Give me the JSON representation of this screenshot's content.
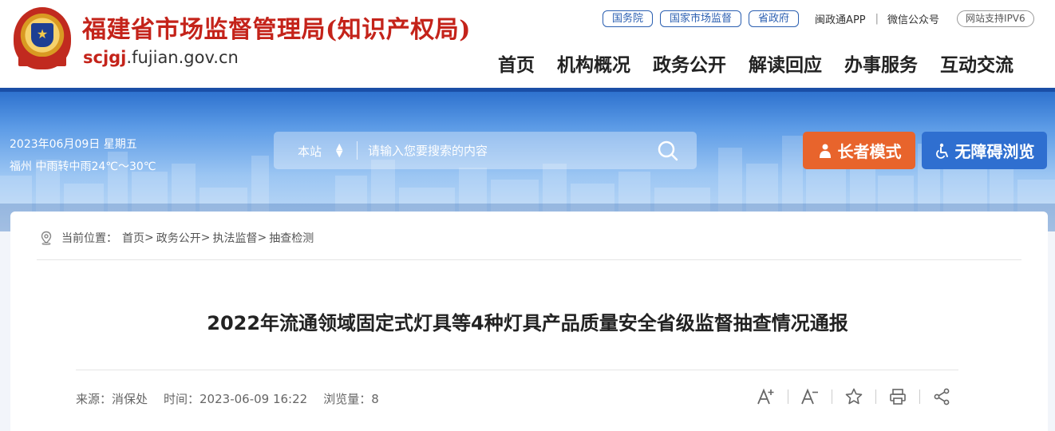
{
  "header": {
    "site_title": "福建省市场监督管理局(知识产权局)",
    "domain_prefix": "scjgj",
    "domain_suffix": ".fujian.gov.cn",
    "emblem_icon": "police-style-emblem-icon",
    "top_links": {
      "pills": [
        "国务院",
        "国家市场监督",
        "省政府"
      ],
      "app": "闽政通APP",
      "wechat": "微信公众号",
      "ipv6": "网站支持IPV6"
    },
    "nav": [
      "首页",
      "机构概况",
      "政务公开",
      "解读回应",
      "办事服务",
      "互动交流"
    ]
  },
  "banner": {
    "date": "2023年06月09日  星期五",
    "weather": "福州  中雨转中雨24℃～30℃",
    "search": {
      "scope": "本站",
      "placeholder": "请输入您要搜索的内容"
    },
    "elder_button": "长者模式",
    "access_button": "无障碍浏览"
  },
  "breadcrumb": {
    "label": "当前位置：",
    "items": [
      "首页",
      "政务公开",
      "执法监督",
      "抽查检测"
    ]
  },
  "article": {
    "title": "2022年流通领域固定式灯具等4种灯具产品质量安全省级监督抽查情况通报",
    "source": "来源：消保处",
    "time": "时间：2023-06-09 16:22",
    "views": "浏览量：8"
  },
  "colors": {
    "brand_red": "#c4231a",
    "brand_blue": "#2b5fb1",
    "elder_orange": "#e8642c"
  }
}
